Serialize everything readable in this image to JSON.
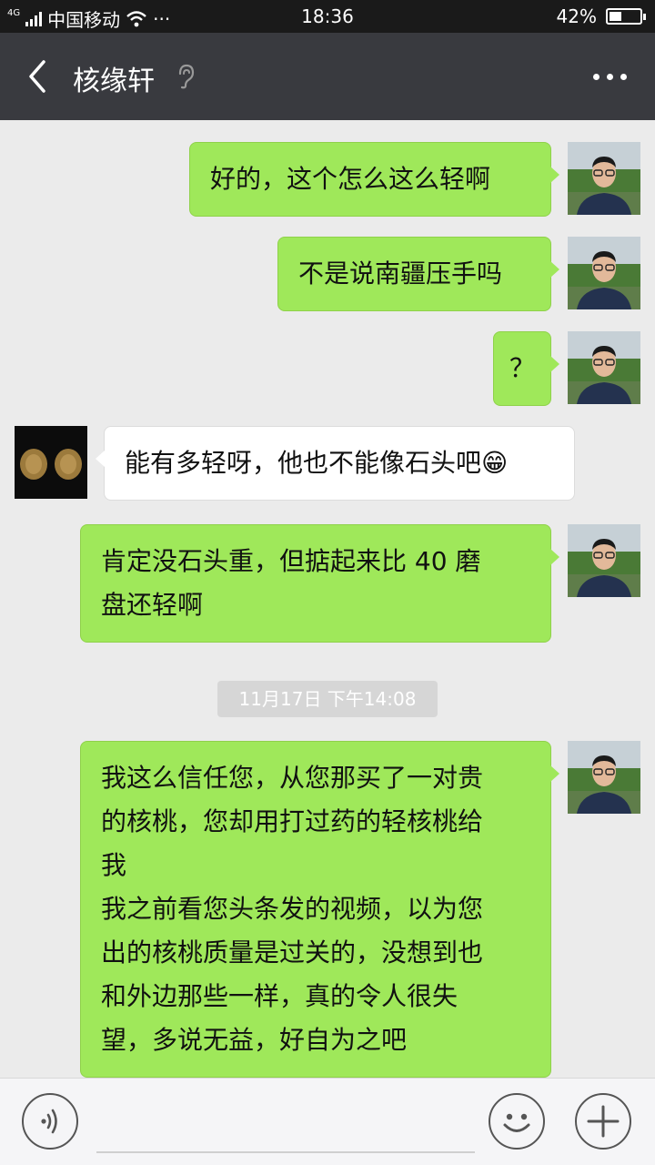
{
  "status_bar": {
    "network": "4G",
    "carrier": "中国移动",
    "more": "···",
    "time": "18:36",
    "battery_percent": "42%",
    "battery_level": 0.42
  },
  "header": {
    "title": "核缘轩"
  },
  "timestamp": "11月17日 下午14:08",
  "messages": [
    {
      "sender": "self",
      "text": "好的，这个怎么这么轻啊"
    },
    {
      "sender": "self",
      "text": "不是说南疆压手吗"
    },
    {
      "sender": "self",
      "text": "？"
    },
    {
      "sender": "other",
      "text": "能有多轻呀，他也不能像石头吧😁"
    },
    {
      "sender": "self",
      "text": "肯定没石头重，但掂起来比 40 磨\n盘还轻啊"
    },
    {
      "sender": "self",
      "text": "我这么信任您，从您那买了一对贵\n的核桃，您却用打过药的轻核桃给\n我\n我之前看您头条发的视频，以为您\n出的核桃质量是过关的，没想到也\n和外边那些一样，真的令人很失\n望，多说无益，好自为之吧"
    }
  ],
  "input": {
    "value": "",
    "placeholder": ""
  },
  "colors": {
    "header_bg": "#393a3f",
    "self_bubble": "#9fe85a",
    "other_bubble": "#ffffff",
    "chat_bg": "#ebebeb"
  }
}
